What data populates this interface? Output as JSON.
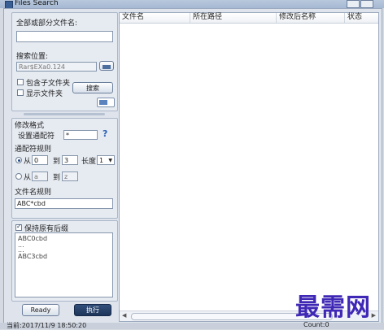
{
  "window": {
    "title": "Files Search"
  },
  "left": {
    "name_label": "全部或部分文件名:",
    "name_value": "",
    "location_label": "搜索位置:",
    "location_value": "Rar$EXa0.124",
    "include_subfolders": "包含子文件夹",
    "show_folders": "显示文件夹",
    "search_button": "搜索",
    "modify_format_label": "修改格式",
    "set_wildcard_label": "设置通配符",
    "wildcard_value": "*",
    "help_symbol": "?",
    "wildcard_rule_label": "通配符规则",
    "from_label": "从",
    "from_value": "0",
    "to_label": "到",
    "to_value": "3",
    "length_label": "长度",
    "length_value": "1",
    "from2_label": "从",
    "from2_value": "a",
    "to2_label": "到",
    "to2_value": "z",
    "filename_rule_label": "文件名规则",
    "filename_rule_value": "ABC*cbd",
    "keep_ext_label": "保持原有后缀",
    "preview": [
      "ABC0cbd",
      "...",
      "...",
      "ABC3cbd"
    ],
    "ready_button": "Ready",
    "execute_button": "执行"
  },
  "table": {
    "columns": [
      "文件名",
      "所在路径",
      "修改后名称",
      "状态"
    ]
  },
  "status": {
    "time": "当前:2017/11/9 18:50:20",
    "count": "Count:0"
  },
  "watermark": "最需网",
  "colors": {
    "accent": "#1d3559",
    "watermark": "#3f28b5"
  }
}
